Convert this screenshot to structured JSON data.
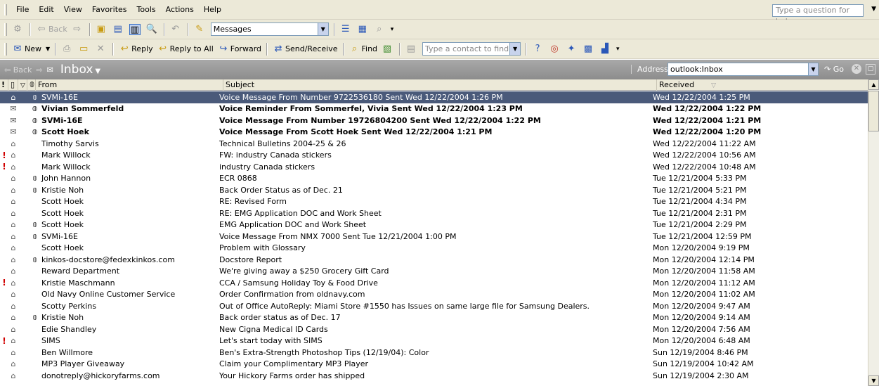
{
  "menu": {
    "items": [
      {
        "label": "File",
        "u": "F"
      },
      {
        "label": "Edit",
        "u": "E"
      },
      {
        "label": "View",
        "u": "V"
      },
      {
        "label": "Favorites",
        "u": "o"
      },
      {
        "label": "Tools",
        "u": "T"
      },
      {
        "label": "Actions",
        "u": "A"
      },
      {
        "label": "Help",
        "u": "H"
      }
    ],
    "help_placeholder": "Type a question for help"
  },
  "toolbar1": {
    "back_label": "Back",
    "view_combo": "Messages"
  },
  "toolbar2": {
    "new_label": "New",
    "reply_label": "Reply",
    "reply_all_label": "Reply to All",
    "forward_label": "Forward",
    "send_receive_label": "Send/Receive",
    "find_label": "Find",
    "contact_placeholder": "Type a contact to find"
  },
  "navbar": {
    "back_label": "Back",
    "folder_title": "Inbox",
    "address_label": "Address",
    "address_value": "outlook:Inbox",
    "go_label": "Go"
  },
  "columns": {
    "importance": "!",
    "from": "From",
    "subject": "Subject",
    "received": "Received"
  },
  "colors": {
    "selected_row": "#4a5a7a",
    "importance_flag": "#d00000",
    "navbar": "#8c8c8c"
  },
  "messages": [
    {
      "from": "SVMi-16E",
      "subject": "Voice Message From Number 9722536180 Sent Wed 12/22/2004 1:26 PM",
      "received": "Wed 12/22/2004 1:25 PM",
      "icon": "envelope-open-icon",
      "attachment": true,
      "unread": false,
      "important": false,
      "selected": true
    },
    {
      "from": "Vivian Sommerfeld",
      "subject": "Voice Reminder From Sommerfel, Vivia Sent Wed 12/22/2004 1:23 PM",
      "received": "Wed 12/22/2004 1:22 PM",
      "icon": "envelope-closed-icon",
      "attachment": true,
      "unread": true,
      "important": false,
      "selected": false
    },
    {
      "from": "SVMi-16E",
      "subject": "Voice Message From Number 19726804200 Sent Wed 12/22/2004 1:22 PM",
      "received": "Wed 12/22/2004 1:21 PM",
      "icon": "envelope-closed-icon",
      "attachment": true,
      "unread": true,
      "important": false,
      "selected": false
    },
    {
      "from": "Scott Hoek",
      "subject": "Voice Message From Scott Hoek Sent Wed 12/22/2004 1:21 PM",
      "received": "Wed 12/22/2004 1:20 PM",
      "icon": "envelope-closed-icon",
      "attachment": true,
      "unread": true,
      "important": false,
      "selected": false
    },
    {
      "from": "Timothy Sarvis",
      "subject": "Technical Bulletins 2004-25 & 26",
      "received": "Wed 12/22/2004 11:22 AM",
      "icon": "envelope-open-icon",
      "attachment": false,
      "unread": false,
      "important": false,
      "selected": false
    },
    {
      "from": "Mark Willock",
      "subject": "FW: industry Canada  stickers",
      "received": "Wed 12/22/2004 10:56 AM",
      "icon": "envelope-open-icon",
      "attachment": false,
      "unread": false,
      "important": true,
      "selected": false
    },
    {
      "from": "Mark Willock",
      "subject": "industry Canada  stickers",
      "received": "Wed 12/22/2004 10:48 AM",
      "icon": "envelope-open-icon",
      "attachment": false,
      "unread": false,
      "important": true,
      "selected": false
    },
    {
      "from": "John Hannon",
      "subject": "ECR 0868",
      "received": "Tue 12/21/2004 5:33 PM",
      "icon": "envelope-open-icon",
      "attachment": true,
      "unread": false,
      "important": false,
      "selected": false
    },
    {
      "from": "Kristie Noh",
      "subject": "Back Order Status as of Dec. 21",
      "received": "Tue 12/21/2004 5:21 PM",
      "icon": "envelope-open-icon",
      "attachment": true,
      "unread": false,
      "important": false,
      "selected": false
    },
    {
      "from": "Scott Hoek",
      "subject": "RE: Revised Form",
      "received": "Tue 12/21/2004 4:34 PM",
      "icon": "envelope-open-icon",
      "attachment": false,
      "unread": false,
      "important": false,
      "selected": false
    },
    {
      "from": "Scott Hoek",
      "subject": "RE: EMG Application DOC and Work Sheet",
      "received": "Tue 12/21/2004 2:31 PM",
      "icon": "envelope-open-icon",
      "attachment": false,
      "unread": false,
      "important": false,
      "selected": false
    },
    {
      "from": "Scott Hoek",
      "subject": "EMG Application DOC and Work Sheet",
      "received": "Tue 12/21/2004 2:29 PM",
      "icon": "envelope-replied-icon",
      "attachment": true,
      "unread": false,
      "important": false,
      "selected": false
    },
    {
      "from": "SVMi-16E",
      "subject": "Voice Message From NMX 7000 Sent Tue 12/21/2004 1:00 PM",
      "received": "Tue 12/21/2004 12:59 PM",
      "icon": "envelope-open-icon",
      "attachment": true,
      "unread": false,
      "important": false,
      "selected": false
    },
    {
      "from": "Scott Hoek",
      "subject": "Problem with Glossary",
      "received": "Mon 12/20/2004 9:19 PM",
      "icon": "envelope-open-icon",
      "attachment": false,
      "unread": false,
      "important": false,
      "selected": false
    },
    {
      "from": "kinkos-docstore@fedexkinkos.com",
      "subject": "Docstore Report",
      "received": "Mon 12/20/2004 12:14 PM",
      "icon": "envelope-forwarded-icon",
      "attachment": true,
      "unread": false,
      "important": false,
      "selected": false
    },
    {
      "from": "Reward Department",
      "subject": "We're giving away a $250 Grocery Gift Card",
      "received": "Mon 12/20/2004 11:58 AM",
      "icon": "envelope-open-icon",
      "attachment": false,
      "unread": false,
      "important": false,
      "selected": false
    },
    {
      "from": "Kristie Maschmann",
      "subject": "CCA / Samsung Holiday Toy & Food Drive",
      "received": "Mon 12/20/2004 11:12 AM",
      "icon": "envelope-open-icon",
      "attachment": false,
      "unread": false,
      "important": true,
      "selected": false
    },
    {
      "from": "Old Navy Online Customer Service",
      "subject": "Order Confirmation from oldnavy.com",
      "received": "Mon 12/20/2004 11:02 AM",
      "icon": "envelope-open-icon",
      "attachment": false,
      "unread": false,
      "important": false,
      "selected": false
    },
    {
      "from": "Scotty Perkins",
      "subject": "Out of Office AutoReply: Miami Store #1550 has Issues on same large file for Samsung Dealers.",
      "received": "Mon 12/20/2004 9:47 AM",
      "icon": "envelope-open-icon",
      "attachment": false,
      "unread": false,
      "important": false,
      "selected": false
    },
    {
      "from": "Kristie Noh",
      "subject": "Back order status as of Dec. 17",
      "received": "Mon 12/20/2004 9:14 AM",
      "icon": "envelope-open-icon",
      "attachment": true,
      "unread": false,
      "important": false,
      "selected": false
    },
    {
      "from": "Edie Shandley",
      "subject": "New Cigna Medical ID Cards",
      "received": "Mon 12/20/2004 7:56 AM",
      "icon": "envelope-open-icon",
      "attachment": false,
      "unread": false,
      "important": false,
      "selected": false
    },
    {
      "from": "SIMS",
      "subject": "Let's start today with SIMS",
      "received": "Mon 12/20/2004 6:48 AM",
      "icon": "envelope-open-icon",
      "attachment": false,
      "unread": false,
      "important": true,
      "selected": false
    },
    {
      "from": "Ben Willmore",
      "subject": "Ben's Extra-Strength Photoshop Tips (12/19/04): Color",
      "received": "Sun 12/19/2004 8:46 PM",
      "icon": "envelope-open-icon",
      "attachment": false,
      "unread": false,
      "important": false,
      "selected": false
    },
    {
      "from": "MP3 Player Giveaway",
      "subject": "Claim your Complimentary MP3 Player",
      "received": "Sun 12/19/2004 10:42 AM",
      "icon": "envelope-open-icon",
      "attachment": false,
      "unread": false,
      "important": false,
      "selected": false
    },
    {
      "from": "donotreply@hickoryfarms.com",
      "subject": "Your Hickory Farms order has shipped",
      "received": "Sun 12/19/2004 2:30 AM",
      "icon": "envelope-open-icon",
      "attachment": false,
      "unread": false,
      "important": false,
      "selected": false
    }
  ]
}
